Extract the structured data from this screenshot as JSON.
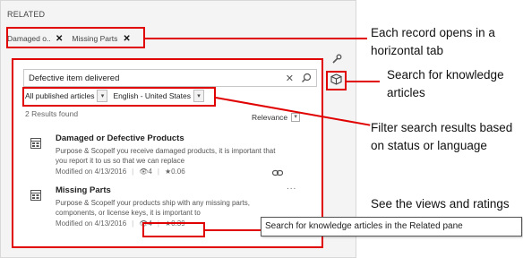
{
  "related": {
    "title": "RELATED",
    "tabs": [
      {
        "label": "Damaged o..."
      },
      {
        "label": "Missing Parts"
      }
    ],
    "close_glyph": "✕"
  },
  "search": {
    "value": "Defective item delivered",
    "clear_glyph": "✕"
  },
  "filters": {
    "status": "All published articles",
    "language": "English - United States",
    "arrow_glyph": "▾"
  },
  "results": {
    "count_text": "2 Results found",
    "sort_label": "Relevance",
    "items": [
      {
        "title": "Damaged or Defective Products",
        "description": "Purpose & Scopelf you receive damaged products, it is important that you report it to us so that we can replace",
        "modified": "Modified on 4/13/2016",
        "views": "4",
        "rating": "0.06",
        "more": "..."
      },
      {
        "title": "Missing Parts",
        "description": "Purpose & Scopelf your products ship with any missing parts, components, or license keys, it is important to",
        "modified": "Modified on 4/13/2016",
        "views": "4",
        "rating": "0.39",
        "more": "..."
      }
    ]
  },
  "annotations": {
    "tabs_note": "Each record opens in a horizontal tab",
    "search_note": "Search for knowledge articles",
    "filter_note": "Filter search results based on status or language",
    "views_note": "See the views and ratings for each article"
  },
  "tooltip": "Search for knowledge articles in the Related pane",
  "colors": {
    "callout": "#e00000",
    "panel": "#f4f4f4"
  },
  "icons": [
    "close-icon",
    "search-icon",
    "article-icon",
    "link-icon",
    "eye-icon",
    "star-icon",
    "wrench-icon",
    "knowledge-icon"
  ]
}
